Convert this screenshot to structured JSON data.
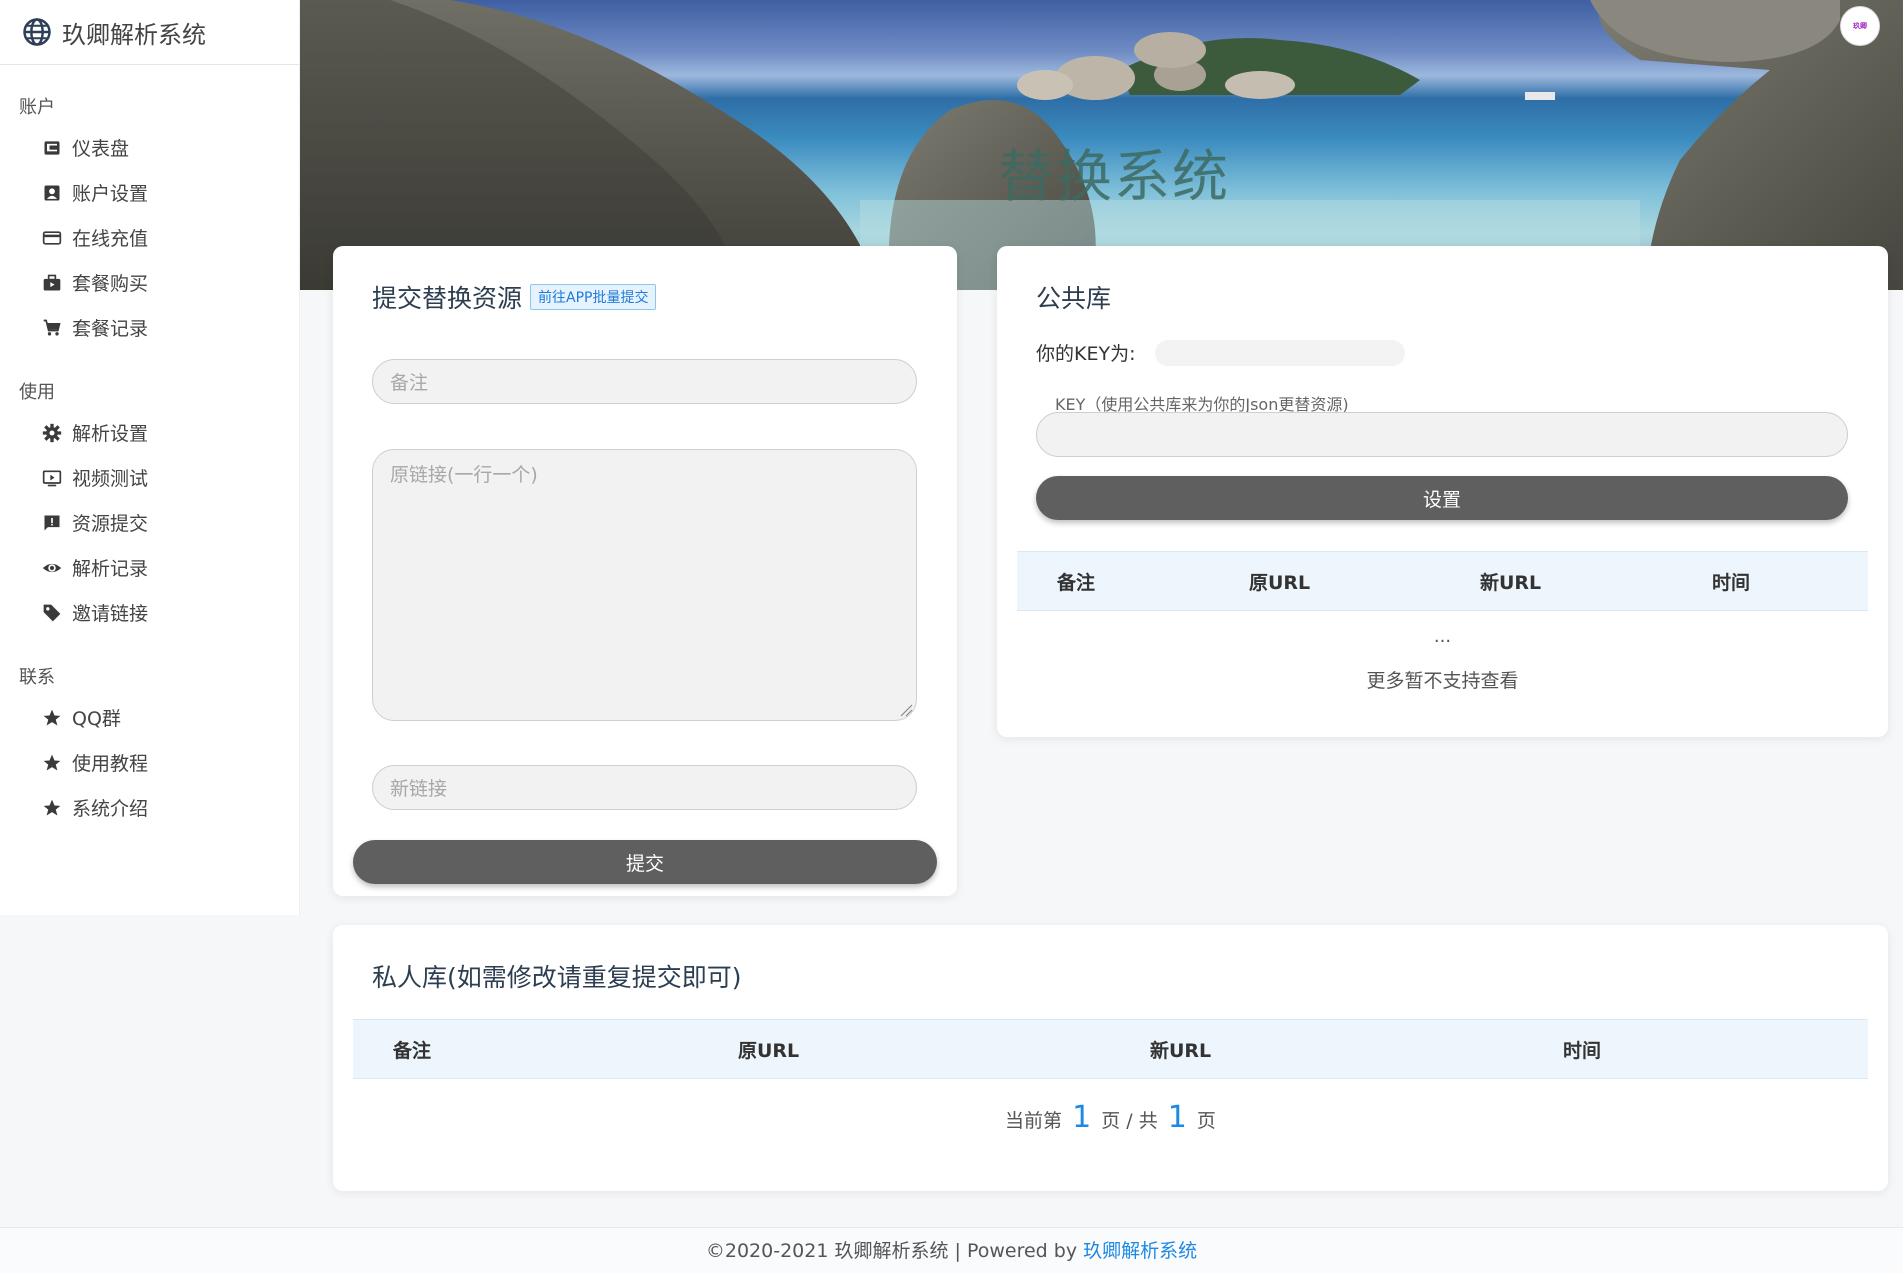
{
  "brand": {
    "title": "玖卿解析系统",
    "icon": "globe-icon"
  },
  "sidebar": {
    "sections": [
      {
        "label": "账户",
        "items": [
          {
            "label": "仪表盘",
            "icon": "dashboard-icon"
          },
          {
            "label": "账户设置",
            "icon": "account-box-icon"
          },
          {
            "label": "在线充值",
            "icon": "credit-card-icon"
          },
          {
            "label": "套餐购买",
            "icon": "briefcase-icon"
          },
          {
            "label": "套餐记录",
            "icon": "cart-icon"
          }
        ]
      },
      {
        "label": "使用",
        "items": [
          {
            "label": "解析设置",
            "icon": "gear-icon"
          },
          {
            "label": "视频测试",
            "icon": "video-icon"
          },
          {
            "label": "资源提交",
            "icon": "feedback-icon"
          },
          {
            "label": "解析记录",
            "icon": "eye-icon"
          },
          {
            "label": "邀请链接",
            "icon": "tag-icon"
          }
        ]
      },
      {
        "label": "联系",
        "items": [
          {
            "label": "QQ群",
            "icon": "star-icon"
          },
          {
            "label": "使用教程",
            "icon": "star-icon"
          },
          {
            "label": "系统介绍",
            "icon": "star-icon"
          }
        ]
      }
    ]
  },
  "hero": {
    "title": "替换系统",
    "avatar_text": "玖卿"
  },
  "submit_card": {
    "title": "提交替换资源",
    "app_link": "前往APP批量提交",
    "remark_placeholder": "备注",
    "origin_placeholder": "原链接(一行一个)",
    "new_placeholder": "新链接",
    "submit_label": "提交"
  },
  "public_card": {
    "title": "公共库",
    "key_label": "你的KEY为:",
    "key_caption": "KEY（使用公共库来为你的Json更替资源)",
    "set_label": "设置",
    "columns": [
      "备注",
      "原URL",
      "新URL",
      "时间"
    ],
    "ellipsis": "...",
    "more_text": "更多暂不支持查看"
  },
  "private_card": {
    "title": "私人库(如需修改请重复提交即可)",
    "columns": [
      "备注",
      "原URL",
      "新URL",
      "时间"
    ],
    "pager": {
      "prefix": "当前第",
      "current": "1",
      "middle": "页 / 共",
      "total": "1",
      "suffix": "页"
    }
  },
  "footer": {
    "text": "©2020-2021 玖卿解析系统 | Powered by",
    "link": "玖卿解析系统"
  },
  "colors": {
    "accent": "#1e88e5",
    "button": "#5f5f5f",
    "table_header": "#eef6fd"
  }
}
